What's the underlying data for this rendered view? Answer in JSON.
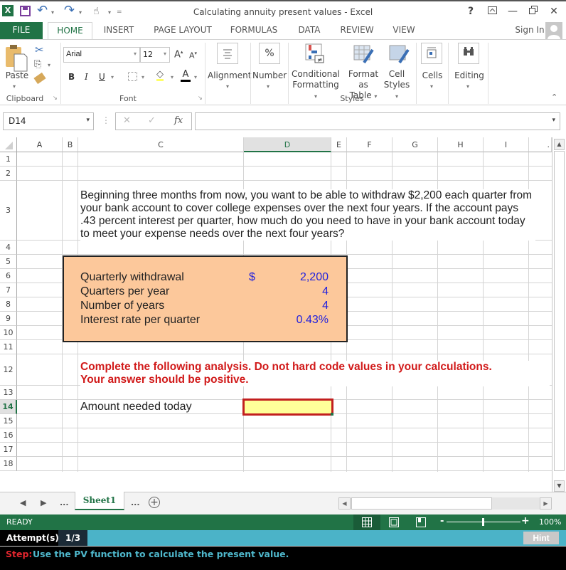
{
  "window": {
    "title": "Calculating annuity present values - Excel",
    "help": "?",
    "ribbon_display": "⊼",
    "minimize": "—",
    "restore": "🗗",
    "close": "✕"
  },
  "quick_access": {
    "excel_logo": "X",
    "save_icon": "💾",
    "undo_icon": "↶",
    "redo_icon": "↷",
    "touch_icon": "☝",
    "customize_icon": "="
  },
  "tabs": [
    {
      "label": "FILE"
    },
    {
      "label": "HOME"
    },
    {
      "label": "INSERT"
    },
    {
      "label": "PAGE LAYOUT"
    },
    {
      "label": "FORMULAS"
    },
    {
      "label": "DATA"
    },
    {
      "label": "REVIEW"
    },
    {
      "label": "VIEW"
    }
  ],
  "sign_in": "Sign In",
  "ribbon": {
    "clipboard": {
      "paste": "Paste",
      "group": "Clipboard"
    },
    "font": {
      "name": "Arial",
      "size": "12",
      "bold": "B",
      "italic": "I",
      "underline": "U",
      "group": "Font",
      "grow": "A",
      "shrink": "A",
      "font_color": "A"
    },
    "alignment": {
      "label": "Alignment"
    },
    "number": {
      "label": "Number",
      "icon": "%"
    },
    "styles": {
      "conditional_formatting": [
        "Conditional",
        "Formatting"
      ],
      "format_as_table": [
        "Format as",
        "Table"
      ],
      "cell_styles": [
        "Cell",
        "Styles"
      ],
      "group": "Styles"
    },
    "cells": {
      "label": "Cells"
    },
    "editing": {
      "label": "Editing"
    }
  },
  "formula_bar": {
    "name_box": "D14",
    "cancel": "✕",
    "enter": "✓",
    "fx": "fx",
    "formula": ""
  },
  "grid": {
    "columns": [
      "A",
      "B",
      "C",
      "D",
      "E",
      "F",
      "G",
      "H",
      "I",
      "."
    ],
    "selected_column": "D",
    "rows": [
      "1",
      "2",
      "3",
      "4",
      "5",
      "6",
      "7",
      "8",
      "9",
      "10",
      "11",
      "12",
      "13",
      "14",
      "15",
      "16",
      "17",
      "18"
    ],
    "selected_row": "14",
    "problem_text": "Beginning three months from now, you want to be able to withdraw $2,200 each quarter from your bank account to cover college expenses over the next four years. If the account pays .43 percent interest per quarter, how much do you need to have in your bank account today to meet your expense needs over the next four years?",
    "inputs": [
      {
        "label": "Quarterly withdrawal",
        "currency": "$",
        "value": "2,200"
      },
      {
        "label": "Quarters per year",
        "currency": "",
        "value": "4"
      },
      {
        "label": "Number of years",
        "currency": "",
        "value": "4"
      },
      {
        "label": "Interest rate per quarter",
        "currency": "",
        "value": "0.43%"
      }
    ],
    "instruction_line1": "Complete the following analysis. Do not hard code values in your calculations.",
    "instruction_line2": "Your answer should be positive.",
    "answer_label": "Amount needed today",
    "answer_value": ""
  },
  "sheets": {
    "prev": "◀",
    "next": "▶",
    "ellipsis_left": "...",
    "active": "Sheet1",
    "ellipsis_right": "...",
    "add": "+"
  },
  "status": {
    "ready": "READY",
    "zoom_minus": "-",
    "zoom_plus": "+",
    "zoom_level": "100%"
  },
  "attempt": {
    "label": "Attempt(s)",
    "count": "1/3",
    "hint": "Hint"
  },
  "step": {
    "prefix": "Step:",
    "text": "Use the PV function to calculate the present value."
  },
  "colors": {
    "excel_green": "#217346",
    "input_box": "#fcc89b",
    "answer_fill": "#ffff99",
    "answer_border": "#c21f1f",
    "instruction_red": "#d11a1a",
    "input_value_blue": "#2222dd",
    "attempt_bar": "#4bb3c8"
  }
}
